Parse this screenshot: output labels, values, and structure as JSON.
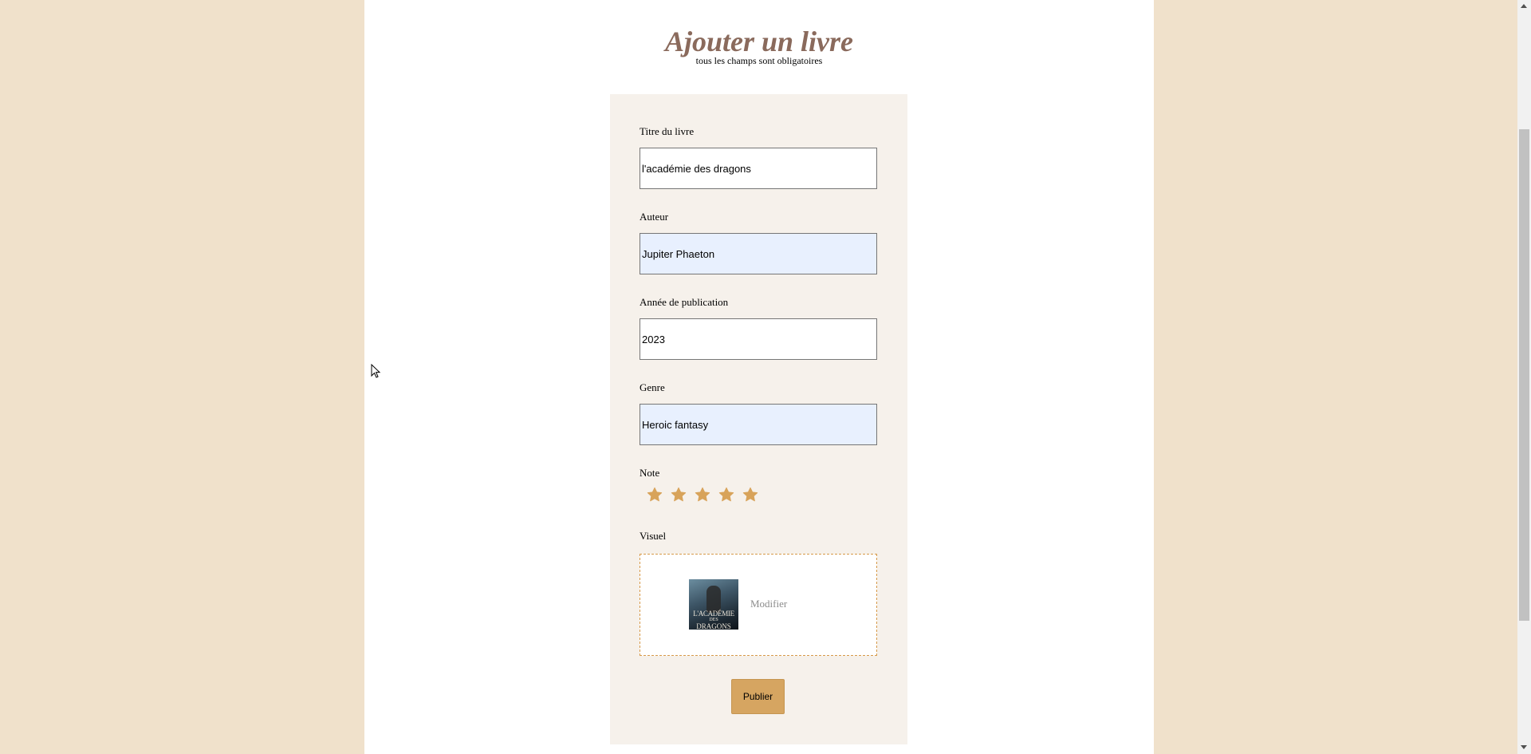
{
  "header": {
    "title": "Ajouter un livre",
    "subtitle": "tous les champs sont obligatoires"
  },
  "form": {
    "fields": [
      {
        "label": "Titre du livre",
        "value": "l'académie des dragons"
      },
      {
        "label": "Auteur",
        "value": "Jupiter Phaeton"
      },
      {
        "label": "Année de publication",
        "value": "2023"
      },
      {
        "label": "Genre",
        "value": "Heroic fantasy"
      }
    ],
    "rating": {
      "label": "Note",
      "value": 5,
      "max": 5,
      "star_color": "#d8a35a"
    },
    "visual": {
      "label": "Visuel",
      "cover_text": [
        "L'ACADÉMIE",
        "DES",
        "DRAGONS"
      ],
      "modify_label": "Modifier"
    },
    "submit_label": "Publier"
  },
  "colors": {
    "background": "#f0e1cb",
    "card": "#f6f1eb",
    "title": "#8a6a5c",
    "accent": "#d6a561",
    "autofill": "#e8f0fe"
  }
}
